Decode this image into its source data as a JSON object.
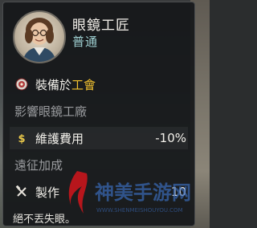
{
  "card": {
    "name": "眼鏡工匠",
    "rarity": "普通",
    "assignment_prefix": "裝備於",
    "assignment_target": "工會",
    "section_influence": "影響眼鏡工廠",
    "upkeep_label": "維護費用",
    "upkeep_value": "-10%",
    "section_expedition": "遠征加成",
    "crafting_label": "製作",
    "crafting_value": "10",
    "footer_note": "絕不丟失眼。"
  },
  "icons": {
    "guild": "guild-emblem-icon",
    "coin": "coin-icon",
    "crafting": "crossed-tools-icon"
  },
  "colors": {
    "highlight": "#f2c230",
    "rarity": "#9fd0d2",
    "section": "#9a9c9f"
  }
}
